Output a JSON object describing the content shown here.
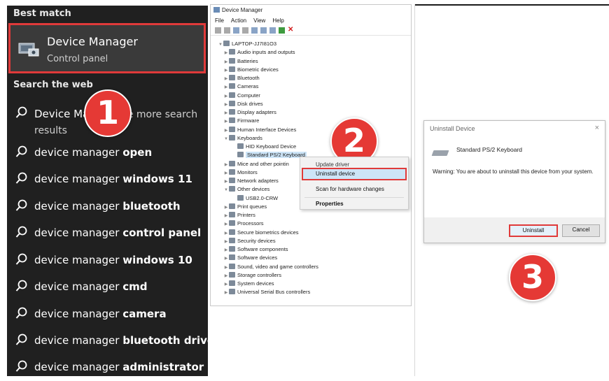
{
  "search": {
    "best_match_heading": "Best match",
    "best_match": {
      "title": "Device Manager",
      "subtitle": "Control panel"
    },
    "search_web_heading": "Search the web",
    "results": [
      {
        "prefix": "Device Ma",
        "bold": "",
        "suffix": "ee more search results"
      },
      {
        "prefix": "device manager ",
        "bold": "open",
        "suffix": ""
      },
      {
        "prefix": "device manager ",
        "bold": "windows 11",
        "suffix": ""
      },
      {
        "prefix": "device manager ",
        "bold": "bluetooth",
        "suffix": ""
      },
      {
        "prefix": "device manager ",
        "bold": "control panel",
        "suffix": ""
      },
      {
        "prefix": "device manager ",
        "bold": "windows 10",
        "suffix": ""
      },
      {
        "prefix": "device manager ",
        "bold": "cmd",
        "suffix": ""
      },
      {
        "prefix": "device manager ",
        "bold": "camera",
        "suffix": ""
      },
      {
        "prefix": "device manager ",
        "bold": "bluetooth driver",
        "suffix": ""
      },
      {
        "prefix": "device manager ",
        "bold": "administrator",
        "suffix": ""
      }
    ]
  },
  "steps": [
    "1",
    "2",
    "3"
  ],
  "device_manager": {
    "title": "Device Manager",
    "menu": [
      "File",
      "Action",
      "View",
      "Help"
    ],
    "tree": [
      {
        "label": "LAPTOP-JJ7I81O3",
        "level": 0,
        "arrow": "v"
      },
      {
        "label": "Audio inputs and outputs",
        "level": 1,
        "arrow": ">"
      },
      {
        "label": "Batteries",
        "level": 1,
        "arrow": ">"
      },
      {
        "label": "Biometric devices",
        "level": 1,
        "arrow": ">"
      },
      {
        "label": "Bluetooth",
        "level": 1,
        "arrow": ">"
      },
      {
        "label": "Cameras",
        "level": 1,
        "arrow": ">"
      },
      {
        "label": "Computer",
        "level": 1,
        "arrow": ">"
      },
      {
        "label": "Disk drives",
        "level": 1,
        "arrow": ">"
      },
      {
        "label": "Display adapters",
        "level": 1,
        "arrow": ">"
      },
      {
        "label": "Firmware",
        "level": 1,
        "arrow": ">"
      },
      {
        "label": "Human Interface Devices",
        "level": 1,
        "arrow": ">"
      },
      {
        "label": "Keyboards",
        "level": 1,
        "arrow": "v"
      },
      {
        "label": "HID Keyboard Device",
        "level": 2,
        "arrow": ""
      },
      {
        "label": "Standard PS/2 Keyboard",
        "level": 2,
        "arrow": "",
        "selected": true
      },
      {
        "label": "Mice and other pointin",
        "level": 1,
        "arrow": ">"
      },
      {
        "label": "Monitors",
        "level": 1,
        "arrow": ">"
      },
      {
        "label": "Network adapters",
        "level": 1,
        "arrow": ">"
      },
      {
        "label": "Other devices",
        "level": 1,
        "arrow": "v"
      },
      {
        "label": "USB2.0-CRW",
        "level": 2,
        "arrow": ""
      },
      {
        "label": "Print queues",
        "level": 1,
        "arrow": ">"
      },
      {
        "label": "Printers",
        "level": 1,
        "arrow": ">"
      },
      {
        "label": "Processors",
        "level": 1,
        "arrow": ">"
      },
      {
        "label": "Secure biometrics devices",
        "level": 1,
        "arrow": ">"
      },
      {
        "label": "Security devices",
        "level": 1,
        "arrow": ">"
      },
      {
        "label": "Software components",
        "level": 1,
        "arrow": ">"
      },
      {
        "label": "Software devices",
        "level": 1,
        "arrow": ">"
      },
      {
        "label": "Sound, video and game controllers",
        "level": 1,
        "arrow": ">"
      },
      {
        "label": "Storage controllers",
        "level": 1,
        "arrow": ">"
      },
      {
        "label": "System devices",
        "level": 1,
        "arrow": ">"
      },
      {
        "label": "Universal Serial Bus controllers",
        "level": 1,
        "arrow": ">"
      }
    ],
    "context_menu": {
      "partial": "Update driver",
      "uninstall": "Uninstall device",
      "scan": "Scan for hardware changes",
      "properties": "Properties"
    }
  },
  "dialog": {
    "title": "Uninstall Device",
    "close": "×",
    "device_name": "Standard PS/2 Keyboard",
    "warning": "Warning: You are about to uninstall this device from your system.",
    "uninstall_label": "Uninstall",
    "cancel_label": "Cancel"
  },
  "colors": {
    "highlight_red": "#e03a3a",
    "badge_red": "#e53935",
    "search_bg": "#202020",
    "selection_blue": "#cce4f7"
  }
}
